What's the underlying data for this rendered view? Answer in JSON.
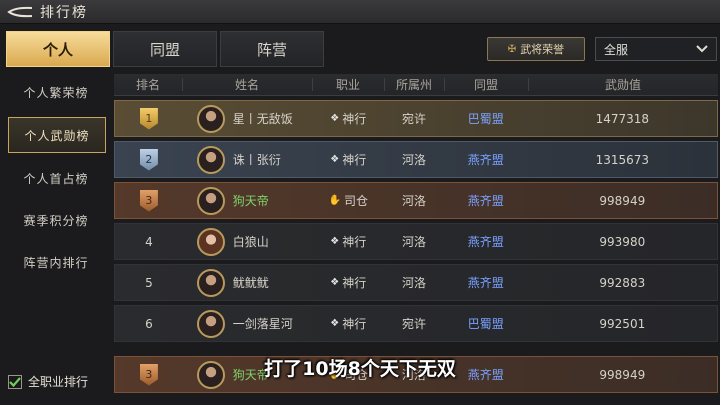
{
  "header": {
    "title": "排行榜",
    "back_icon": "back-arrow-icon"
  },
  "tabs": [
    {
      "label": "个人",
      "active": true
    },
    {
      "label": "同盟",
      "active": false
    },
    {
      "label": "阵营",
      "active": false
    }
  ],
  "honor_button": {
    "label": "武将荣誉"
  },
  "server_select": {
    "value": "全服"
  },
  "sidebar": {
    "items": [
      {
        "label": "个人繁荣榜"
      },
      {
        "label": "个人武勋榜",
        "active": true
      },
      {
        "label": "个人首占榜"
      },
      {
        "label": "赛季积分榜"
      },
      {
        "label": "阵营内排行"
      }
    ],
    "filter": {
      "label": "全职业排行",
      "checked": true
    }
  },
  "table": {
    "headers": [
      "排名",
      "姓名",
      "职业",
      "所属州",
      "同盟",
      "武勋值"
    ],
    "rows": [
      {
        "rank": "1",
        "medal": "gold",
        "name": "星丨无敌饭",
        "job": "神行",
        "state": "宛许",
        "alliance": "巴蜀盟",
        "value": "1477318"
      },
      {
        "rank": "2",
        "medal": "silver",
        "name": "诛丨张衍",
        "job": "神行",
        "state": "河洛",
        "alliance": "燕齐盟",
        "value": "1315673"
      },
      {
        "rank": "3",
        "medal": "bronze",
        "name": "狗天帝",
        "job": "司仓",
        "state": "河洛",
        "alliance": "燕齐盟",
        "value": "998949"
      },
      {
        "rank": "4",
        "medal": "",
        "name": "白狼山",
        "job": "神行",
        "state": "河洛",
        "alliance": "燕齐盟",
        "value": "993980"
      },
      {
        "rank": "5",
        "medal": "",
        "name": "鱿鱿鱿",
        "job": "神行",
        "state": "河洛",
        "alliance": "燕齐盟",
        "value": "992883"
      },
      {
        "rank": "6",
        "medal": "",
        "name": "一剑落星河",
        "job": "神行",
        "state": "宛许",
        "alliance": "巴蜀盟",
        "value": "992501"
      },
      {
        "rank": "3",
        "medal": "bronze",
        "name": "狗天帝",
        "job": "司仓",
        "state": "河洛",
        "alliance": "燕齐盟",
        "value": "998949"
      }
    ]
  },
  "subtitle": "打了10场8个天下无双"
}
